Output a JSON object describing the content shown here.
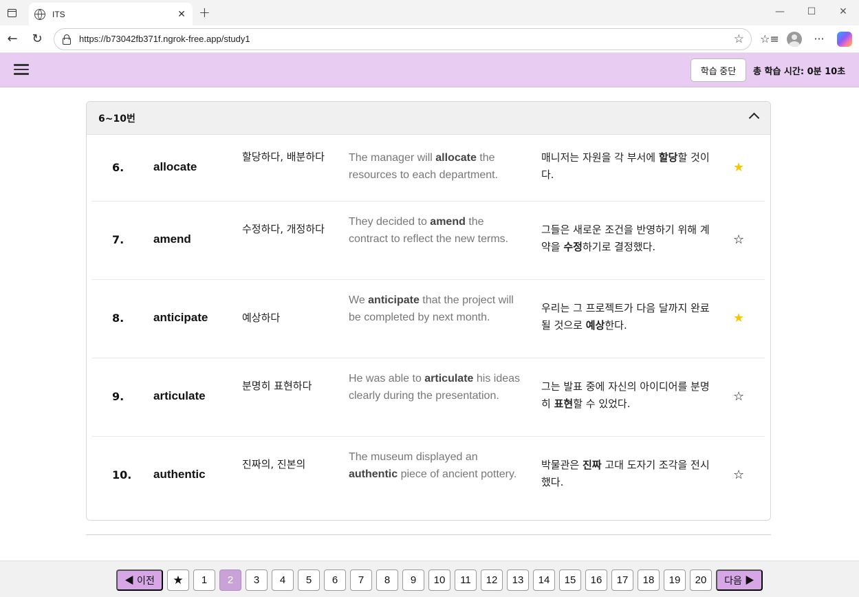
{
  "browser": {
    "tab_title": "ITS",
    "url": "https://b73042fb371f.ngrok-free.app/study1"
  },
  "header": {
    "stop_button": "학습 중단",
    "timer_text": "총 학습 시간: 0분 10초"
  },
  "section": {
    "title": "6~10번"
  },
  "words": [
    {
      "num": "6.",
      "word": "allocate",
      "meaning": "할당하다, 배분하다",
      "ex_pre": "The manager will ",
      "ex_bold": "allocate",
      "ex_post": " the resources to each department.",
      "kr_pre": "매니저는 자원을 각 부서에 ",
      "kr_bold": "할당",
      "kr_post": "할 것이다.",
      "starred": true
    },
    {
      "num": "7.",
      "word": "amend",
      "meaning": "수정하다, 개정하다",
      "ex_pre": "They decided to ",
      "ex_bold": "amend",
      "ex_post": " the contract to reflect the new terms.",
      "kr_pre": "그들은 새로운 조건을 반영하기 위해 계약을 ",
      "kr_bold": "수정",
      "kr_post": "하기로 결정했다.",
      "starred": false
    },
    {
      "num": "8.",
      "word": "anticipate",
      "meaning": "예상하다",
      "ex_pre": "We ",
      "ex_bold": "anticipate",
      "ex_post": " that the project will be completed by next month.",
      "kr_pre": "우리는 그 프로젝트가 다음 달까지 완료될 것으로 ",
      "kr_bold": "예상",
      "kr_post": "한다.",
      "starred": true
    },
    {
      "num": "9.",
      "word": "articulate",
      "meaning": "분명히 표현하다",
      "ex_pre": "He was able to ",
      "ex_bold": "articulate",
      "ex_post": " his ideas clearly during the presentation.",
      "kr_pre": "그는 발표 중에 자신의 아이디어를 분명히 ",
      "kr_bold": "표현",
      "kr_post": "할 수 있었다.",
      "starred": false
    },
    {
      "num": "10.",
      "word": "authentic",
      "meaning": "진짜의, 진본의",
      "ex_pre": "The museum displayed an ",
      "ex_bold": "authentic",
      "ex_post": " piece of ancient pottery.",
      "kr_pre": "박물관은 ",
      "kr_bold": "진짜",
      "kr_post": " 고대 도자기 조각을 전시했다.",
      "starred": false
    }
  ],
  "pagination": {
    "prev_label": "◀ 이전",
    "next_label": "다음 ▶",
    "star_label": "★",
    "pages": [
      "1",
      "2",
      "3",
      "4",
      "5",
      "6",
      "7",
      "8",
      "9",
      "10",
      "11",
      "12",
      "13",
      "14",
      "15",
      "16",
      "17",
      "18",
      "19",
      "20"
    ],
    "current": "2"
  }
}
